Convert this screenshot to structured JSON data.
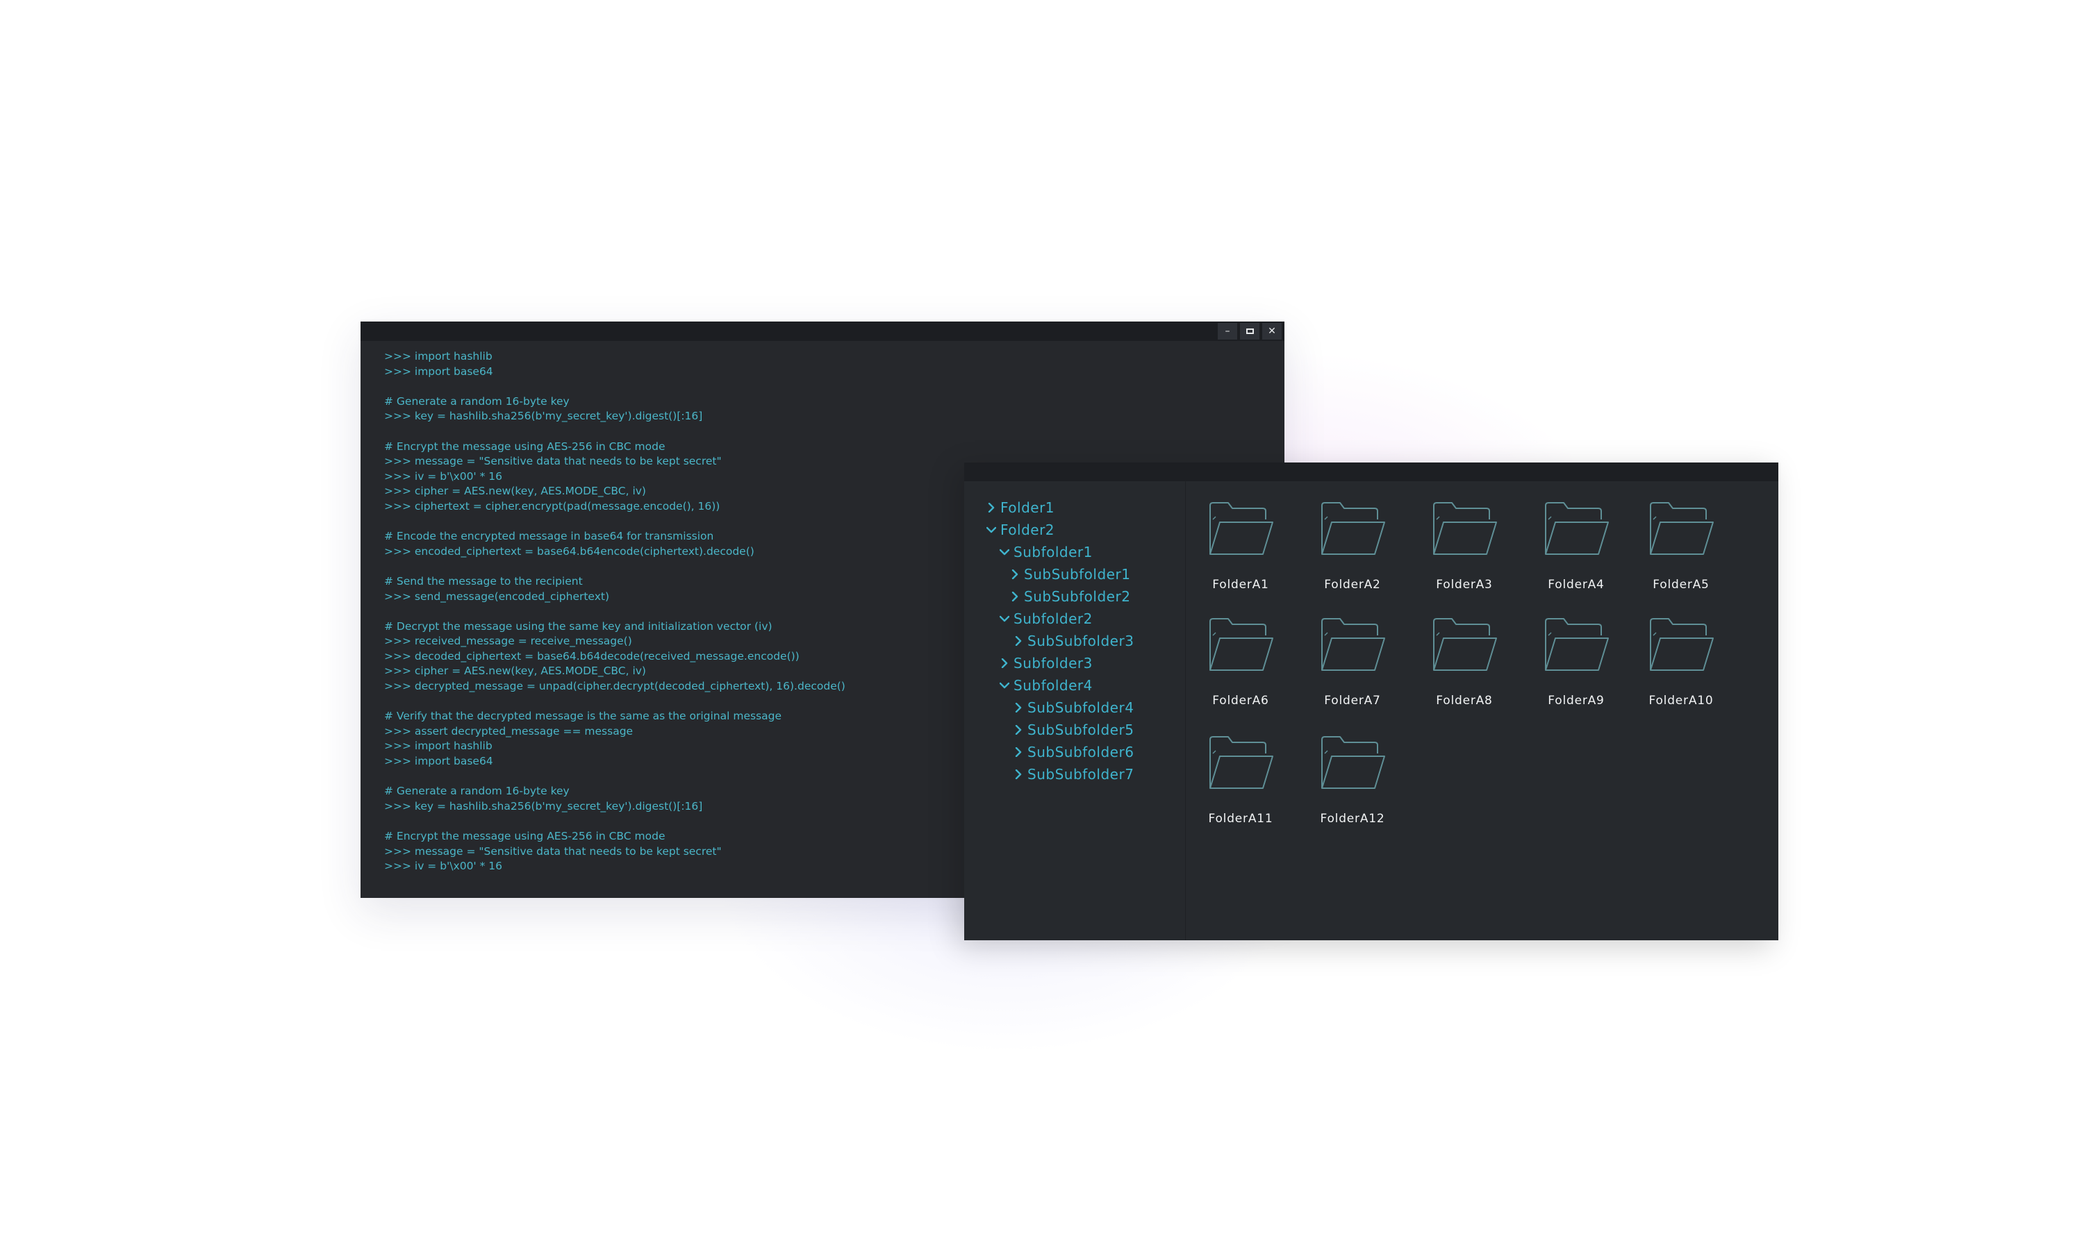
{
  "terminal": {
    "lines": [
      ">>> import hashlib",
      ">>> import base64",
      "",
      "# Generate a random 16-byte key",
      ">>> key = hashlib.sha256(b'my_secret_key').digest()[:16]",
      "",
      "# Encrypt the message using AES-256 in CBC mode",
      ">>> message = \"Sensitive data that needs to be kept secret\"",
      ">>> iv = b'\\x00' * 16",
      ">>> cipher = AES.new(key, AES.MODE_CBC, iv)",
      ">>> ciphertext = cipher.encrypt(pad(message.encode(), 16))",
      "",
      "# Encode the encrypted message in base64 for transmission",
      ">>> encoded_ciphertext = base64.b64encode(ciphertext).decode()",
      "",
      "# Send the message to the recipient",
      ">>> send_message(encoded_ciphertext)",
      "",
      "# Decrypt the message using the same key and initialization vector (iv)",
      ">>> received_message = receive_message()",
      ">>> decoded_ciphertext = base64.b64decode(received_message.encode())",
      ">>> cipher = AES.new(key, AES.MODE_CBC, iv)",
      ">>> decrypted_message = unpad(cipher.decrypt(decoded_ciphertext), 16).decode()",
      "",
      "# Verify that the decrypted message is the same as the original message",
      ">>> assert decrypted_message == message",
      ">>> import hashlib",
      ">>> import base64",
      "",
      "# Generate a random 16-byte key",
      ">>> key = hashlib.sha256(b'my_secret_key').digest()[:16]",
      "",
      "# Encrypt the message using AES-256 in CBC mode",
      ">>> message = \"Sensitive data that needs to be kept secret\"",
      ">>> iv = b'\\x00' * 16"
    ],
    "controls": {
      "minimize": "–",
      "close": "✕"
    }
  },
  "explorer": {
    "tree": [
      {
        "label": "Folder1",
        "state": "collapsed"
      },
      {
        "label": "Folder2",
        "state": "expanded"
      },
      {
        "label": "Subfolder1",
        "state": "expanded"
      },
      {
        "label": "SubSubfolder1",
        "state": "collapsed"
      },
      {
        "label": "SubSubfolder2",
        "state": "collapsed"
      },
      {
        "label": "Subfolder2",
        "state": "expanded"
      },
      {
        "label": "SubSubfolder3",
        "state": "collapsed"
      },
      {
        "label": "Subfolder3",
        "state": "collapsed"
      },
      {
        "label": "Subfolder4",
        "state": "expanded"
      },
      {
        "label": "SubSubfolder4",
        "state": "collapsed"
      },
      {
        "label": "SubSubfolder5",
        "state": "collapsed"
      },
      {
        "label": "SubSubfolder6",
        "state": "collapsed"
      },
      {
        "label": "SubSubfolder7",
        "state": "collapsed"
      }
    ],
    "folders": [
      "FolderA1",
      "FolderA2",
      "FolderA3",
      "FolderA4",
      "FolderA5",
      "FolderA6",
      "FolderA7",
      "FolderA8",
      "FolderA9",
      "FolderA10",
      "FolderA11",
      "FolderA12"
    ],
    "folder_icon": "open-folder-icon"
  },
  "colors": {
    "accent_cyan": "#3fb4cd",
    "window_bg": "#26282c",
    "titlebar_bg": "#1c1e22",
    "folder_outline": "#5f8f96"
  }
}
